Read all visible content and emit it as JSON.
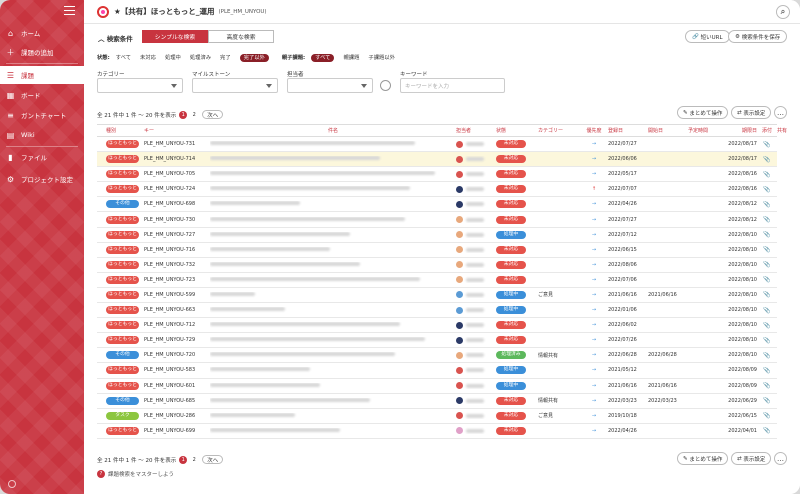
{
  "colors": {
    "brand": "#c8343f",
    "hokkamotto": "#e5534b",
    "sonota": "#3b8fd9",
    "task": "#8cc63f",
    "open": "#e5534b",
    "inprogress": "#3b8fd9",
    "resolved": "#5cb85c"
  },
  "sidebar": {
    "items": [
      {
        "label": "ホーム",
        "icon": "home-icon"
      },
      {
        "label": "課題の追加",
        "icon": "plus-icon"
      },
      {
        "label": "課題",
        "icon": "list-icon"
      },
      {
        "label": "ボード",
        "icon": "board-icon"
      },
      {
        "label": "ガントチャート",
        "icon": "gantt-icon"
      },
      {
        "label": "Wiki",
        "icon": "wiki-icon"
      },
      {
        "label": "ファイル",
        "icon": "folder-icon"
      },
      {
        "label": "プロジェクト設定",
        "icon": "gear-icon"
      }
    ]
  },
  "header": {
    "title": "★【共有】ほっともっと_運用",
    "project_key": "(PLE_HM_UNYOU)"
  },
  "conditions": {
    "title": "検索条件",
    "simple_tab": "シンプルな検索",
    "advanced_tab": "高度な検索",
    "short_url": "短いURL",
    "save_conditions": "検索条件を保存",
    "status_label": "状態:",
    "status_options": [
      "すべて",
      "未対応",
      "処理中",
      "処理済み",
      "完了",
      "完了以外"
    ],
    "parent_label": "親子課題:",
    "parent_options": [
      "すべて",
      "親課題",
      "子課題以外"
    ],
    "category_label": "カテゴリー",
    "milestone_label": "マイルストーン",
    "assignee_label": "担当者",
    "keyword_label": "キーワード",
    "keyword_placeholder": "キーワードを入力"
  },
  "pager": {
    "summary": "全 21 件中 1 件 〜 20 件を表示",
    "pages": [
      "1",
      "2"
    ],
    "next": "次へ"
  },
  "pager_bottom": {
    "summary": "全 21 件中 1 件 〜 20 件を表示",
    "pages": [
      "1",
      "2"
    ],
    "next": "次へ"
  },
  "actions": {
    "bulk": "まとめて操作",
    "display": "表示設定"
  },
  "table": {
    "headers": [
      "種別",
      "キー",
      "件名",
      "担当者",
      "状態",
      "カテゴリー",
      "優先度",
      "登録日",
      "開始日",
      "予定時間",
      "期限日",
      "添付",
      "共有"
    ],
    "rows": [
      {
        "type": "ほっともっと",
        "tc": "hokkamotto",
        "key": "PLE_HM_UNYOU-731",
        "sw": 205,
        "status": "未対応",
        "sc": "open",
        "category": "",
        "priority": "→",
        "reg": "2022/07/27",
        "start": "",
        "est": "",
        "due": "2022/08/17",
        "av": "#d9534f"
      },
      {
        "type": "ほっともっと",
        "tc": "hokkamotto",
        "key": "PLE_HM_UNYOU-714",
        "sw": 170,
        "status": "未対応",
        "sc": "open",
        "category": "",
        "priority": "→",
        "reg": "2022/06/06",
        "start": "",
        "est": "",
        "due": "2022/08/17",
        "av": "#d9534f",
        "hl": true
      },
      {
        "type": "ほっともっと",
        "tc": "hokkamotto",
        "key": "PLE_HM_UNYOU-705",
        "sw": 225,
        "status": "未対応",
        "sc": "open",
        "category": "",
        "priority": "→",
        "reg": "2022/05/17",
        "start": "",
        "est": "",
        "due": "2022/08/16",
        "av": "#d9534f"
      },
      {
        "type": "ほっともっと",
        "tc": "hokkamotto",
        "key": "PLE_HM_UNYOU-724",
        "sw": 200,
        "status": "未対応",
        "sc": "open",
        "category": "",
        "priority": "↑",
        "reg": "2022/07/07",
        "start": "",
        "est": "",
        "due": "2022/08/16",
        "av": "#2b3a67"
      },
      {
        "type": "その他",
        "tc": "sonota",
        "key": "PLE_HM_UNYOU-698",
        "sw": 90,
        "status": "未対応",
        "sc": "open",
        "category": "",
        "priority": "→",
        "reg": "2022/04/26",
        "start": "",
        "est": "",
        "due": "2022/08/12",
        "av": "#2b3a67"
      },
      {
        "type": "ほっともっと",
        "tc": "hokkamotto",
        "key": "PLE_HM_UNYOU-730",
        "sw": 195,
        "status": "未対応",
        "sc": "open",
        "category": "",
        "priority": "→",
        "reg": "2022/07/27",
        "start": "",
        "est": "",
        "due": "2022/08/12",
        "av": "#e8a87c"
      },
      {
        "type": "ほっともっと",
        "tc": "hokkamotto",
        "key": "PLE_HM_UNYOU-727",
        "sw": 140,
        "status": "処理中",
        "sc": "inprogress",
        "category": "",
        "priority": "→",
        "reg": "2022/07/12",
        "start": "",
        "est": "",
        "due": "2022/08/10",
        "av": "#e8a87c"
      },
      {
        "type": "ほっともっと",
        "tc": "hokkamotto",
        "key": "PLE_HM_UNYOU-716",
        "sw": 120,
        "status": "未対応",
        "sc": "open",
        "category": "",
        "priority": "→",
        "reg": "2022/06/15",
        "start": "",
        "est": "",
        "due": "2022/08/10",
        "av": "#e8a87c"
      },
      {
        "type": "ほっともっと",
        "tc": "hokkamotto",
        "key": "PLE_HM_UNYOU-732",
        "sw": 150,
        "status": "未対応",
        "sc": "open",
        "category": "",
        "priority": "→",
        "reg": "2022/08/06",
        "start": "",
        "est": "",
        "due": "2022/08/10",
        "av": "#e8a87c"
      },
      {
        "type": "ほっともっと",
        "tc": "hokkamotto",
        "key": "PLE_HM_UNYOU-723",
        "sw": 210,
        "status": "未対応",
        "sc": "open",
        "category": "",
        "priority": "→",
        "reg": "2022/07/06",
        "start": "",
        "est": "",
        "due": "2022/08/10",
        "av": "#e8a87c"
      },
      {
        "type": "ほっともっと",
        "tc": "hokkamotto",
        "key": "PLE_HM_UNYOU-599",
        "sw": 45,
        "status": "処理中",
        "sc": "inprogress",
        "category": "ご意見",
        "priority": "→",
        "reg": "2021/06/16",
        "start": "2021/06/16",
        "est": "",
        "due": "2022/08/10",
        "av": "#5b9bd5"
      },
      {
        "type": "ほっともっと",
        "tc": "hokkamotto",
        "key": "PLE_HM_UNYOU-663",
        "sw": 75,
        "status": "処理中",
        "sc": "inprogress",
        "category": "",
        "priority": "→",
        "reg": "2022/01/06",
        "start": "",
        "est": "",
        "due": "2022/08/10",
        "av": "#5b9bd5"
      },
      {
        "type": "ほっともっと",
        "tc": "hokkamotto",
        "key": "PLE_HM_UNYOU-712",
        "sw": 190,
        "status": "未対応",
        "sc": "open",
        "category": "",
        "priority": "→",
        "reg": "2022/06/02",
        "start": "",
        "est": "",
        "due": "2022/08/10",
        "av": "#2b3a67"
      },
      {
        "type": "ほっともっと",
        "tc": "hokkamotto",
        "key": "PLE_HM_UNYOU-729",
        "sw": 215,
        "status": "未対応",
        "sc": "open",
        "category": "",
        "priority": "→",
        "reg": "2022/07/26",
        "start": "",
        "est": "",
        "due": "2022/08/10",
        "av": "#2b3a67"
      },
      {
        "type": "その他",
        "tc": "sonota",
        "key": "PLE_HM_UNYOU-720",
        "sw": 185,
        "status": "処理済み",
        "sc": "resolved",
        "category": "情報共有",
        "priority": "→",
        "reg": "2022/06/28",
        "start": "2022/06/28",
        "est": "",
        "due": "2022/08/10",
        "av": "#e8a87c"
      },
      {
        "type": "ほっともっと",
        "tc": "hokkamotto",
        "key": "PLE_HM_UNYOU-583",
        "sw": 100,
        "status": "処理中",
        "sc": "inprogress",
        "category": "",
        "priority": "→",
        "reg": "2021/05/12",
        "start": "",
        "est": "",
        "due": "2022/08/09",
        "av": "#d9534f"
      },
      {
        "type": "ほっともっと",
        "tc": "hokkamotto",
        "key": "PLE_HM_UNYOU-601",
        "sw": 110,
        "status": "処理中",
        "sc": "inprogress",
        "category": "",
        "priority": "→",
        "reg": "2021/06/16",
        "start": "2021/06/16",
        "est": "",
        "due": "2022/08/09",
        "av": "#d9534f"
      },
      {
        "type": "その他",
        "tc": "sonota",
        "key": "PLE_HM_UNYOU-685",
        "sw": 160,
        "status": "未対応",
        "sc": "open",
        "category": "情報共有",
        "priority": "→",
        "reg": "2022/03/23",
        "start": "2022/03/23",
        "est": "",
        "due": "2022/06/29",
        "av": "#2b3a67"
      },
      {
        "type": "タスク",
        "tc": "task",
        "key": "PLE_HM_UNYOU-286",
        "sw": 85,
        "status": "未対応",
        "sc": "open",
        "category": "ご意見",
        "priority": "→",
        "reg": "2019/10/18",
        "start": "",
        "est": "",
        "due": "2022/06/15",
        "av": "#d9534f"
      },
      {
        "type": "ほっともっと",
        "tc": "hokkamotto",
        "key": "PLE_HM_UNYOU-699",
        "sw": 130,
        "status": "未対応",
        "sc": "open",
        "category": "",
        "priority": "→",
        "reg": "2022/04/26",
        "start": "",
        "est": "",
        "due": "2022/04/01",
        "av": "#e0a0c8"
      }
    ]
  },
  "footer": {
    "help_link": "課題検索をマスターしよう"
  }
}
